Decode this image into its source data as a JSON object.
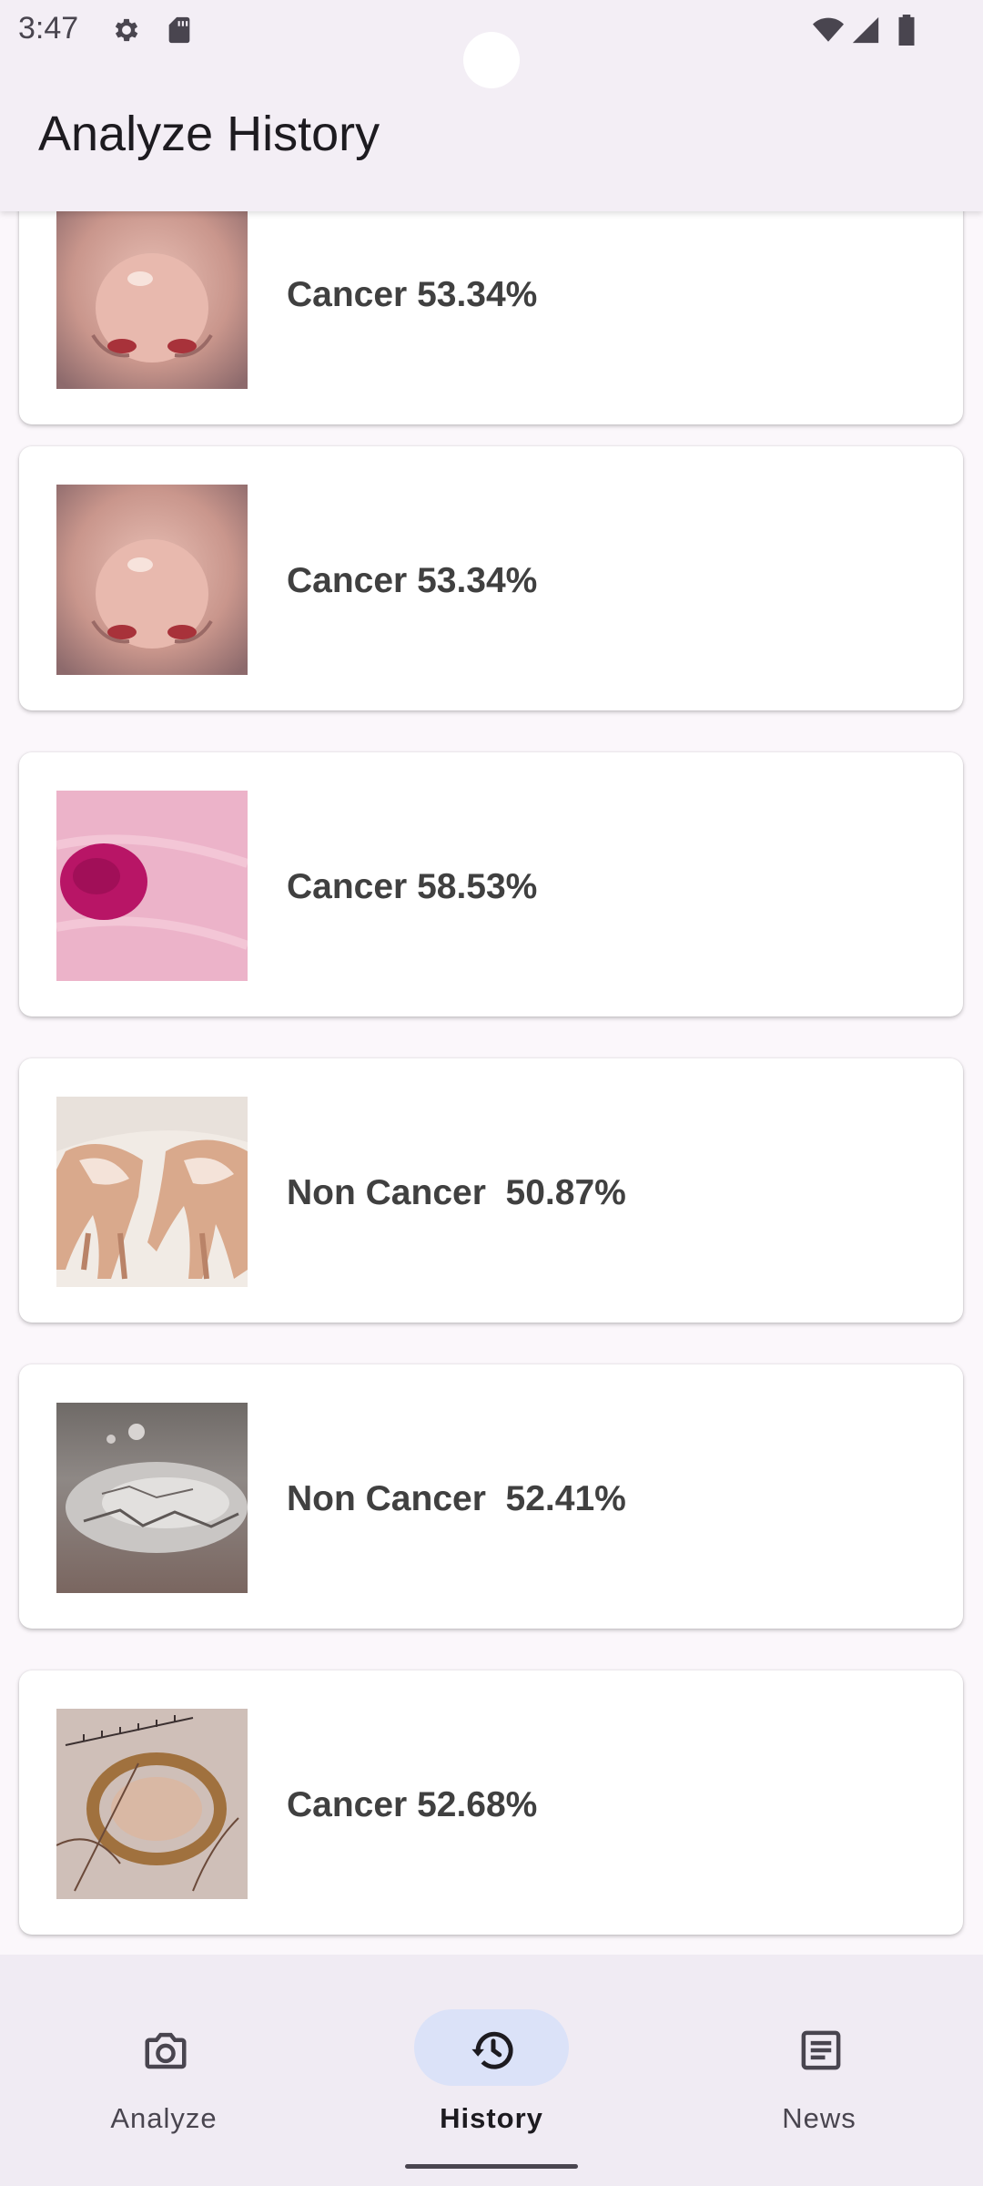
{
  "status_bar": {
    "time": "3:47",
    "icons": [
      "gear-icon",
      "sd-card-icon",
      "wifi-icon",
      "signal-icon",
      "battery-icon"
    ]
  },
  "app_bar": {
    "title": "Analyze History"
  },
  "history": {
    "items": [
      {
        "label": "Cancer 53.34%",
        "image": "nose-photo"
      },
      {
        "label": "Cancer 53.34%",
        "image": "nose-photo"
      },
      {
        "label": "Cancer 58.53%",
        "image": "red-skin-lesion-photo"
      },
      {
        "label": "Non Cancer  50.87%",
        "image": "hands-depigmentation-photo"
      },
      {
        "label": "Non Cancer  52.41%",
        "image": "scaly-skin-photo"
      },
      {
        "label": "Cancer 52.68%",
        "image": "mole-dermoscopy-photo"
      }
    ]
  },
  "bottom_nav": {
    "items": [
      {
        "label": "Analyze",
        "icon": "camera-icon",
        "active": false
      },
      {
        "label": "History",
        "icon": "history-icon",
        "active": true
      },
      {
        "label": "News",
        "icon": "news-icon",
        "active": false
      }
    ]
  },
  "colors": {
    "background": "#fbf7fb",
    "app_bar": "#f3eef5",
    "nav_bar": "#f0ebf3",
    "active_pill": "#dbe2f8",
    "label_text": "#404040"
  }
}
